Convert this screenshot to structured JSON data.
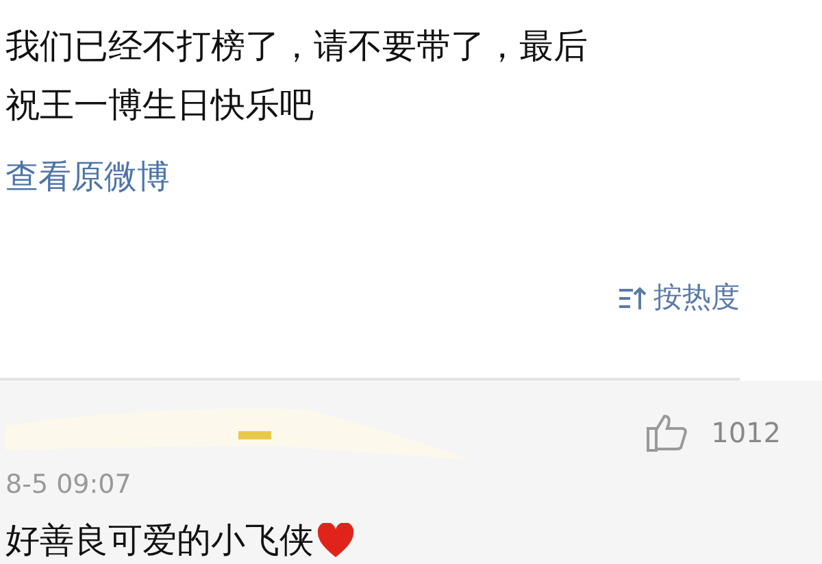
{
  "post": {
    "text_lines": [
      "我们已经不打榜了，请不要带了，最后",
      "祝王一博生日快乐吧"
    ],
    "view_original": "查看原微博"
  },
  "sort": {
    "label": "按热度"
  },
  "comments": [
    {
      "likes": "1012",
      "time": "8-5 09:07",
      "text": "好善良可爱的小飞侠"
    }
  ]
}
